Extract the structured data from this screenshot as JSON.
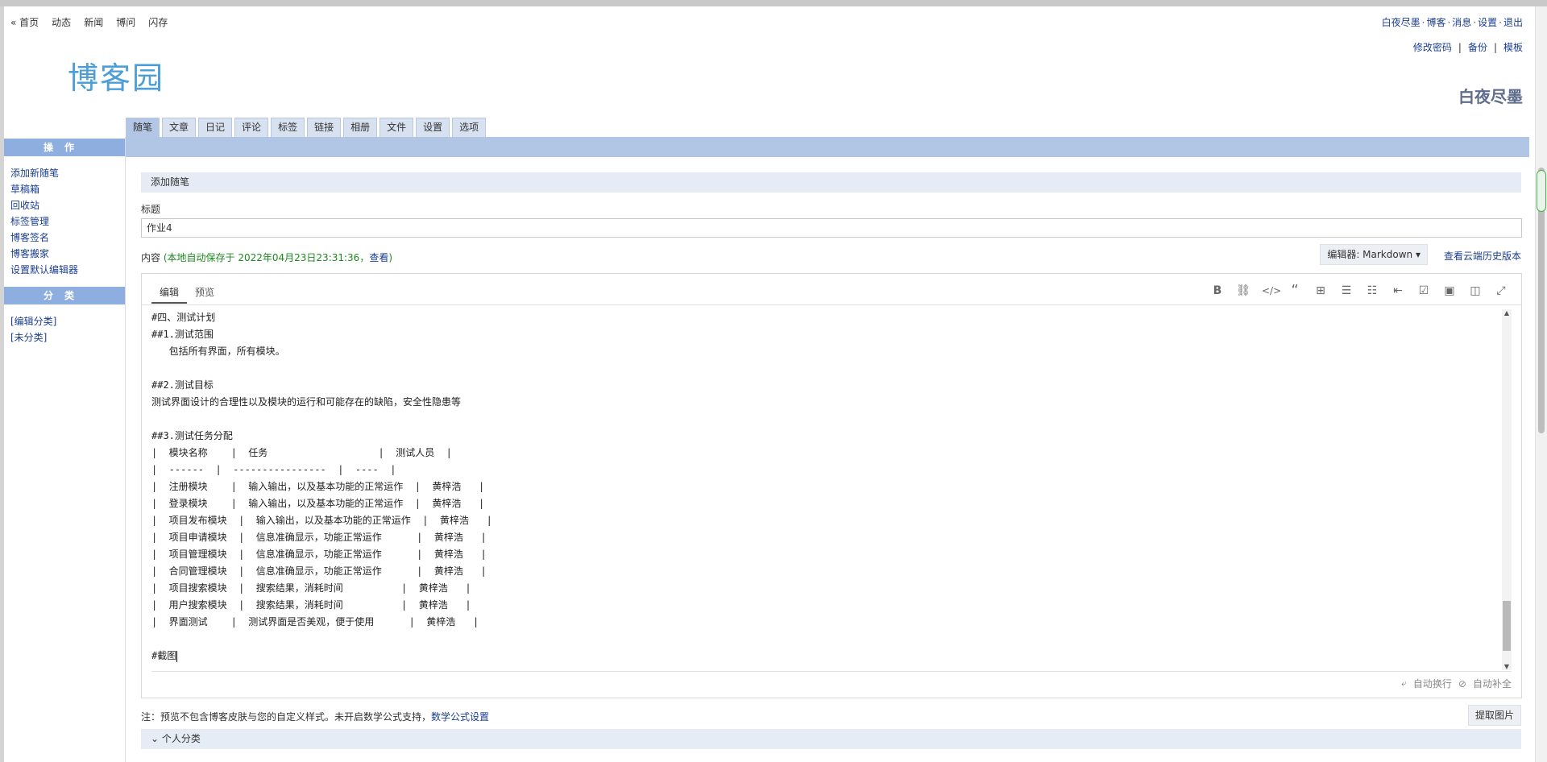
{
  "nav_left": [
    "« 首页",
    "动态",
    "新闻",
    "博问",
    "闪存"
  ],
  "nav_right": [
    "白夜尽墨",
    "博客",
    "消息",
    "设置",
    "退出"
  ],
  "nav_right_sep": "·",
  "account_links": [
    "修改密码",
    "备份",
    "模板"
  ],
  "account_sep": "|",
  "logo_text": "博客园",
  "blog_name": "白夜尽墨",
  "tabs": [
    "随笔",
    "文章",
    "日记",
    "评论",
    "标签",
    "链接",
    "相册",
    "文件",
    "设置",
    "选项"
  ],
  "sidebar": {
    "ops_title": "操作",
    "ops_items": [
      "添加新随笔",
      "草稿箱",
      "回收站",
      "标签管理",
      "博客签名",
      "博客搬家",
      "设置默认编辑器"
    ],
    "cat_title": "分类",
    "cat_items": [
      "[编辑分类]",
      "[未分类]"
    ]
  },
  "main": {
    "section_title": "添加随笔",
    "title_label": "标题",
    "title_value": "作业4",
    "content_label": "内容",
    "autosave_prefix": "(本地自动保存于 2022年04月23日23:31:36，",
    "autosave_view": "查看",
    "autosave_suffix": ")",
    "editor_button": "编辑器: Markdown",
    "history_link": "查看云端历史版本",
    "editor_tabs": [
      "编辑",
      "预览"
    ],
    "code_lines": [
      "#四、测试计划",
      "##1.测试范围",
      "   包括所有界面，所有模块。",
      "",
      "##2.测试目标",
      "测试界面设计的合理性以及模块的运行和可能存在的缺陷，安全性隐患等",
      "",
      "##3.测试任务分配",
      "|  模块名称    |  任务                   |  测试人员  |",
      "|  ------  |  ----------------  |  ----  |",
      "|  注册模块    |  输入输出，以及基本功能的正常运作  |  黄梓浩   |",
      "|  登录模块    |  输入输出，以及基本功能的正常运作  |  黄梓浩   |",
      "|  项目发布模块  |  输入输出，以及基本功能的正常运作  |  黄梓浩   |",
      "|  项目申请模块  |  信息准确显示，功能正常运作      |  黄梓浩   |",
      "|  项目管理模块  |  信息准确显示，功能正常运作      |  黄梓浩   |",
      "|  合同管理模块  |  信息准确显示，功能正常运作      |  黄梓浩   |",
      "|  项目搜索模块  |  搜索结果，消耗时间          |  黄梓浩   |",
      "|  用户搜索模块  |  搜索结果，消耗时间          |  黄梓浩   |",
      "|  界面测试    |  测试界面是否美观，便于使用      |  黄梓浩   |",
      "",
      "#截图"
    ],
    "footer_options": [
      "自动换行",
      "自动补全"
    ],
    "note_text": "注：预览不包含博客皮肤与您的自定义样式。未开启数学公式支持，",
    "note_link": "数学公式设置",
    "extract_button": "提取图片",
    "personal_category": "个人分类"
  }
}
